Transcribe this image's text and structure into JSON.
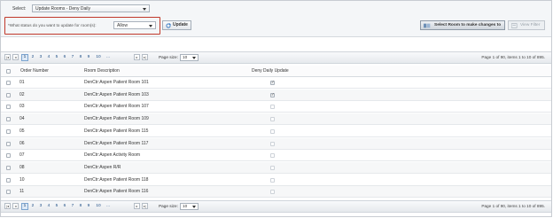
{
  "filter": {
    "select_label": "Select:",
    "select_value": "Update Rooms - Deny Daily",
    "status_question": "*What status do you want to update for room(s):",
    "status_value": "Allow",
    "update_button": "Update",
    "select_room_button": "Select Room to make changes to",
    "view_filter_button": "View Filter"
  },
  "pager": {
    "pages": [
      "1",
      "2",
      "3",
      "4",
      "5",
      "6",
      "7",
      "8",
      "9",
      "10",
      "..."
    ],
    "current_page": "1",
    "page_size_label": "Page size:",
    "page_size_value": "10",
    "info": "Page 1 of 90, items 1 to 10 of 895."
  },
  "grid": {
    "columns": [
      "Order Number",
      "Room Description",
      "Deny Daily Update"
    ],
    "rows": [
      {
        "order": "01",
        "desc": "DenCtr:Aspen Patient Room 101",
        "deny": true
      },
      {
        "order": "02",
        "desc": "DenCtr:Aspen Patient Room 103",
        "deny": true
      },
      {
        "order": "03",
        "desc": "DenCtr:Aspen Patient Room 107",
        "deny": false
      },
      {
        "order": "04",
        "desc": "DenCtr:Aspen Patient Room 109",
        "deny": false
      },
      {
        "order": "05",
        "desc": "DenCtr:Aspen Patient Room 115",
        "deny": false
      },
      {
        "order": "06",
        "desc": "DenCtr:Aspen Patient Room 117",
        "deny": false
      },
      {
        "order": "07",
        "desc": "DenCtr:Aspen Activity Room",
        "deny": false
      },
      {
        "order": "08",
        "desc": "DenCtr:Aspen R/R",
        "deny": false
      },
      {
        "order": "10",
        "desc": "DenCtr:Aspen Patient Room 118",
        "deny": false
      },
      {
        "order": "11",
        "desc": "DenCtr:Aspen Patient Room 116",
        "deny": false
      }
    ]
  },
  "colors": {
    "highlight_border": "#c0392b",
    "link": "#1f4f86",
    "header_bg": "#f4f6f8"
  }
}
